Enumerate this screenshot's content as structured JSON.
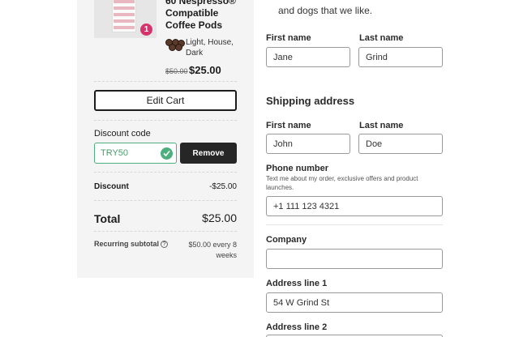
{
  "summary": {
    "product_name": "60 Nespresso® Compatible Coffee Pods",
    "quantity": "1",
    "roast": "Light, House, Dark",
    "original_price": "$50.00",
    "price": "$25.00",
    "edit_cart_label": "Edit Cart",
    "discount_label": "Discount code",
    "discount_code": "TRY50",
    "remove_label": "Remove",
    "discount_row_label": "Discount",
    "discount_row_value": "-$25.00",
    "total_label": "Total",
    "total_value": "$25.00",
    "recurring_label": "Recurring subtotal",
    "recurring_value": "$50.00 every 8 weeks"
  },
  "form": {
    "top_text": "and dogs that we like.",
    "contact": {
      "first_name_label": "First name",
      "first_name_value": "Jane",
      "last_name_label": "Last name",
      "last_name_value": "Grind"
    },
    "shipping_title": "Shipping address",
    "shipping": {
      "first_name_label": "First name",
      "first_name_value": "John",
      "last_name_label": "Last name",
      "last_name_value": "Doe",
      "phone_label": "Phone number",
      "phone_note": "Text me about my order, exclusive offers and product launches.",
      "phone_value": "+1 111 123 4321",
      "company_label": "Company",
      "company_value": "",
      "address1_label": "Address line 1",
      "address1_value": "54 W Grind St",
      "address2_label": "Address line 2"
    }
  },
  "colors": {
    "accent_green": "#4caf7d",
    "badge_pink": "#d6336c",
    "dark_button": "#262626"
  }
}
